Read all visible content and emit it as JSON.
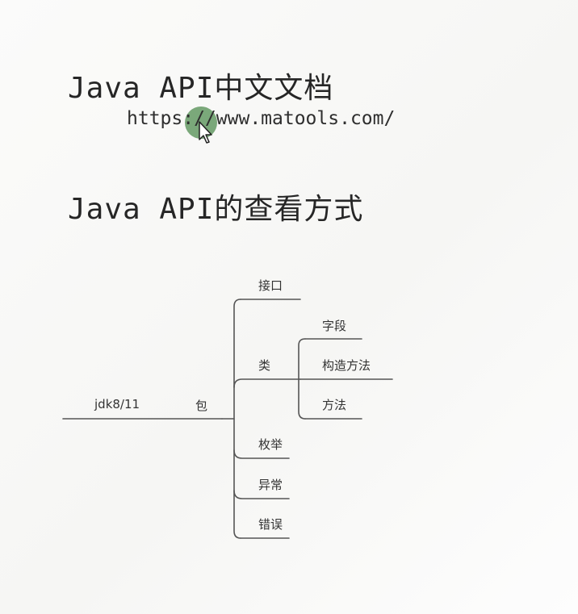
{
  "title_1": "Java API中文文档",
  "url": "https://www.matools.com/",
  "title_2": "Java API的查看方式",
  "mindmap": {
    "root": "jdk8/11",
    "package": "包",
    "children": {
      "interface": "接口",
      "class": "类",
      "enum": "枚举",
      "exception": "异常",
      "error": "错误"
    },
    "class_children": {
      "field": "字段",
      "constructor": "构造方法",
      "method": "方法"
    }
  },
  "colors": {
    "line": "#555555",
    "cursor_highlight": "#508c50"
  }
}
